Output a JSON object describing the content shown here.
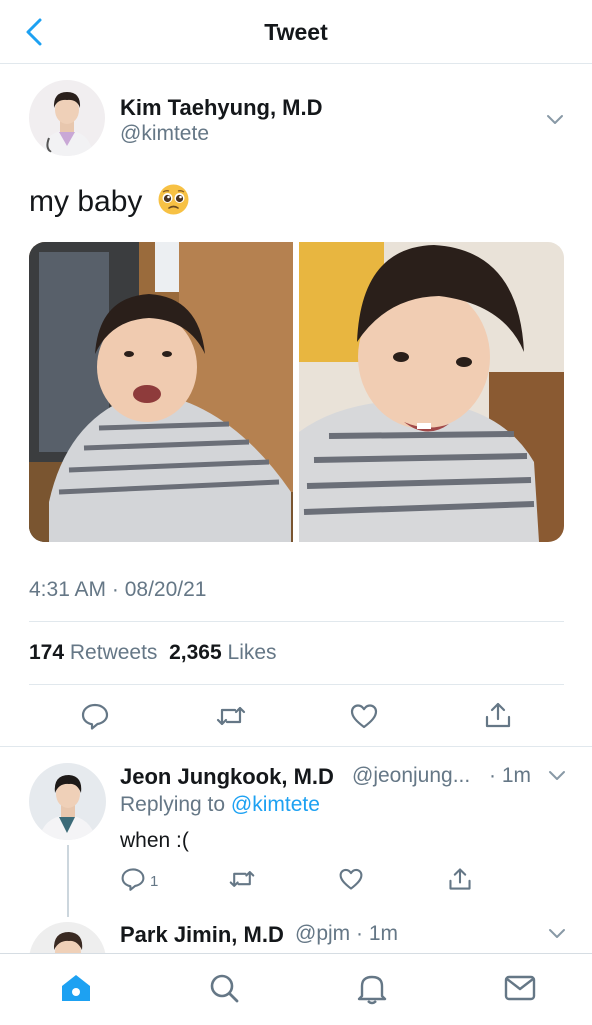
{
  "header": {
    "title": "Tweet"
  },
  "tweet": {
    "author_name": "Kim Taehyung, M.D",
    "author_handle": "@kimtete",
    "text": "my baby",
    "emoji": "pleading-face-emoji",
    "timestamp": "4:31 AM · 08/20/21",
    "retweets_count": "174",
    "retweets_label": "Retweets",
    "likes_count": "2,365",
    "likes_label": "Likes"
  },
  "replies": [
    {
      "author_name": "Jeon Jungkook, M.D",
      "author_handle": "@jeonjung...",
      "time": "· 1m",
      "replying_label": "Replying to",
      "replying_handle": "@kimtete",
      "text": "when :(",
      "reply_count": "1"
    },
    {
      "author_name": "Park Jimin, M.D",
      "author_handle": "@pjm",
      "time": "· 1m"
    }
  ],
  "icons": {
    "back": "chevron-left-icon",
    "more": "chevron-down-icon",
    "reply": "comment-icon",
    "retweet": "retweet-icon",
    "like": "heart-icon",
    "share": "share-icon",
    "home": "home-icon",
    "search": "search-icon",
    "notifications": "bell-icon",
    "messages": "mail-icon"
  },
  "colors": {
    "accent": "#1da1f2",
    "secondary_text": "#657786",
    "divider": "#e1e8ed"
  }
}
